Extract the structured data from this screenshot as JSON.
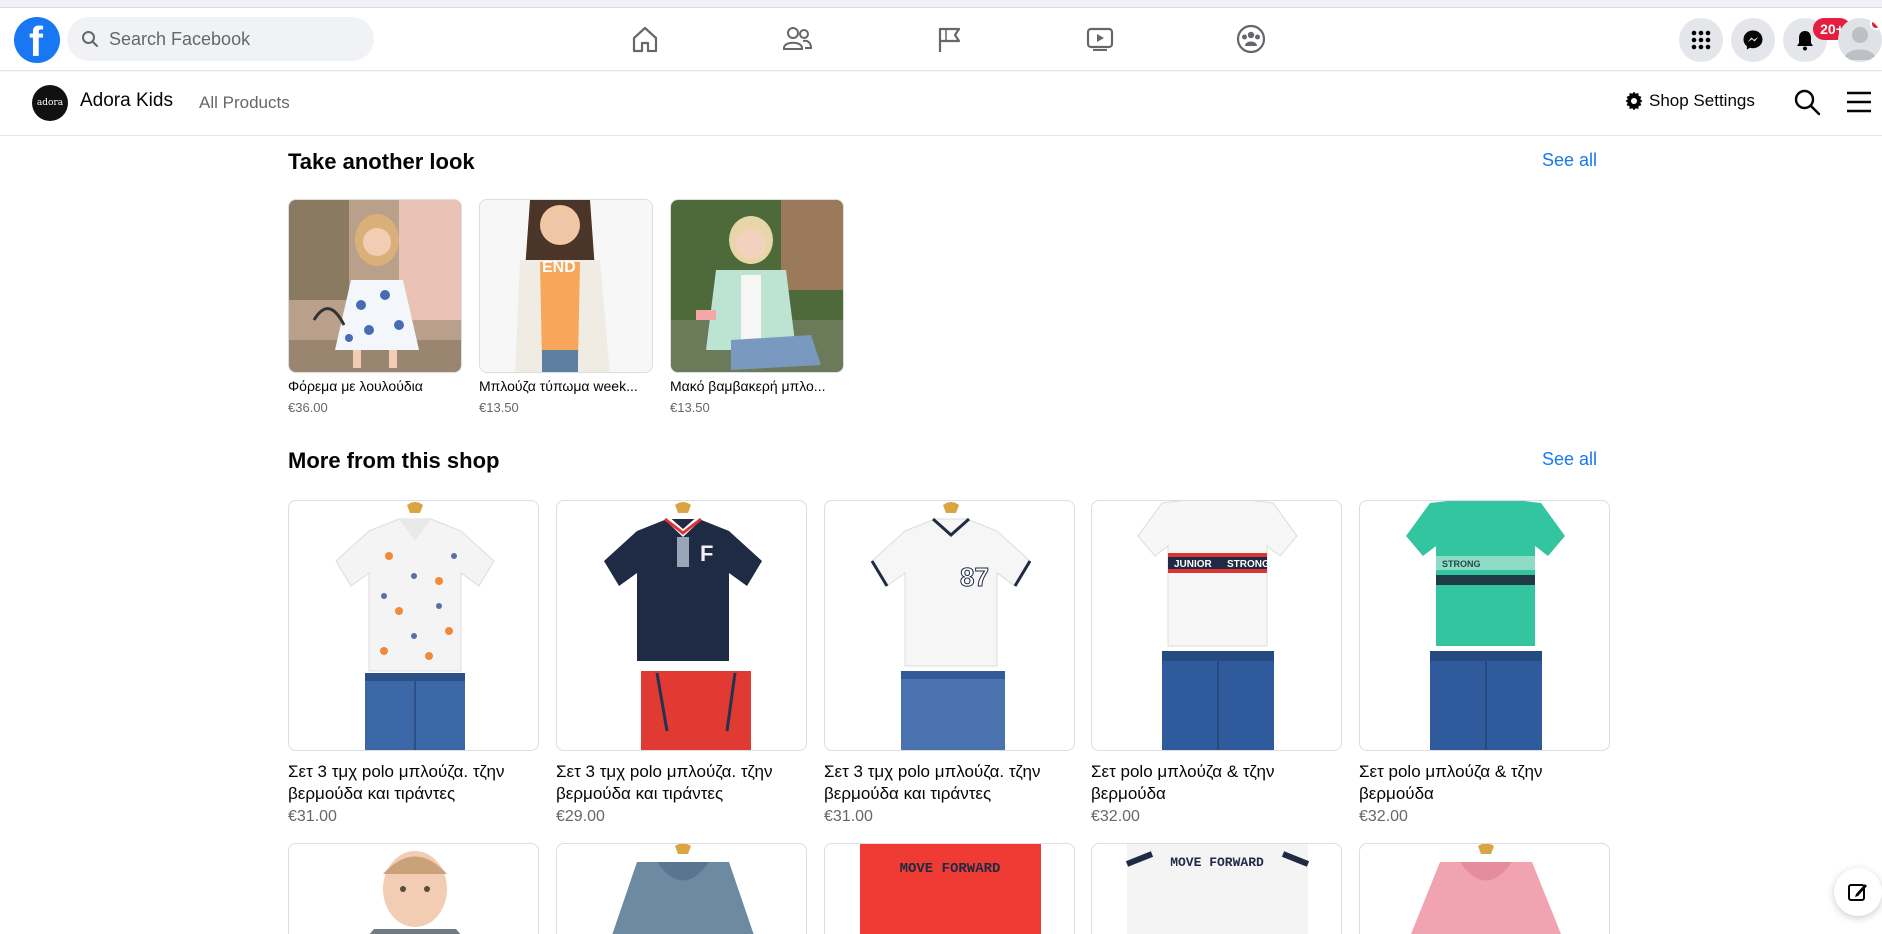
{
  "search": {
    "placeholder": "Search Facebook"
  },
  "nav": {
    "icons": [
      "home-icon",
      "friends-icon",
      "pages-flag-icon",
      "watch-video-icon",
      "groups-icon"
    ],
    "menu_icon": "grid-menu-icon",
    "messenger_icon": "messenger-icon",
    "notifications_icon": "bell-icon",
    "notifications_count": "20+"
  },
  "shop": {
    "name": "Adora Kids",
    "logo_text": "adora",
    "nav_all_products": "All Products",
    "settings_label": "Shop Settings"
  },
  "take_another_look": {
    "title": "Take another look",
    "see_all": "See all",
    "items": [
      {
        "name": "Φόρεμα με λουλούδια",
        "price": "€36.00"
      },
      {
        "name": "Μπλούζα τύπωμα week...",
        "price": "€13.50"
      },
      {
        "name": "Μακό βαμβακερή μπλο...",
        "price": "€13.50"
      }
    ]
  },
  "more_from_shop": {
    "title": "More from this shop",
    "see_all": "See all",
    "items": [
      {
        "name": "Σετ 3 τμχ polo μπλούζα. τζην βερμούδα και τιράντες",
        "price": "€31.00"
      },
      {
        "name": "Σετ 3 τμχ polo μπλούζα. τζην βερμούδα και τιράντες",
        "price": "€29.00"
      },
      {
        "name": "Σετ 3 τμχ polo μπλούζα. τζην βερμούδα και τιράντες",
        "price": "€31.00"
      },
      {
        "name": "Σετ polo μπλούζα & τζην βερμούδα",
        "price": "€32.00"
      },
      {
        "name": "Σετ polo μπλούζα & τζην βερμούδα",
        "price": "€32.00"
      }
    ],
    "printed_texts": [
      "JUNIOR",
      "STRONG",
      "STRONG",
      "MOVE FORWARD",
      "MOVE FORWARD"
    ]
  },
  "colors": {
    "accent": "#1877f2",
    "badge": "#e41e3f"
  }
}
